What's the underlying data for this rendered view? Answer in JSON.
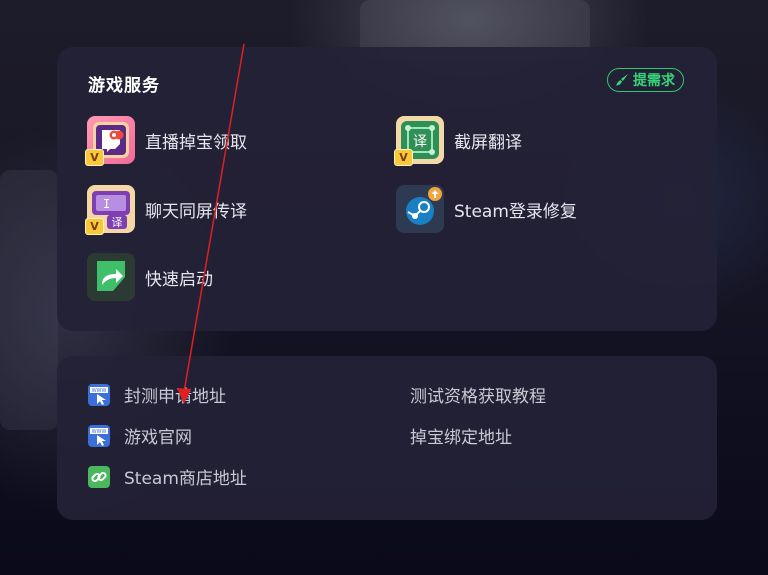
{
  "services_panel": {
    "title": "游戏服务",
    "request_button": "提需求",
    "items": [
      {
        "label": "直播掉宝领取",
        "icon": "twitch-drops-icon"
      },
      {
        "label": "截屏翻译",
        "icon": "screenshot-translate-icon"
      },
      {
        "label": "聊天同屏传译",
        "icon": "chat-translate-icon"
      },
      {
        "label": "Steam登录修复",
        "icon": "steam-icon"
      },
      {
        "label": "快速启动",
        "icon": "quick-launch-icon"
      }
    ]
  },
  "links_panel": {
    "items": [
      {
        "label": "封测申请地址",
        "icon": "web-link-icon"
      },
      {
        "label": "测试资格获取教程",
        "icon": ""
      },
      {
        "label": "游戏官网",
        "icon": "web-link-icon"
      },
      {
        "label": "掉宝绑定地址",
        "icon": ""
      },
      {
        "label": "Steam商店地址",
        "icon": "chain-link-icon"
      }
    ]
  },
  "colors": {
    "accent_green": "#35d67a",
    "panel_bg": "#242236",
    "annotation_red": "#e02020"
  }
}
